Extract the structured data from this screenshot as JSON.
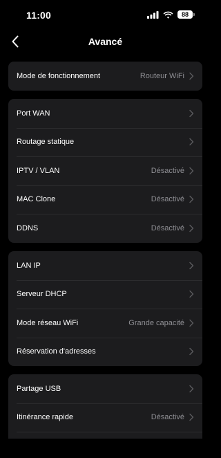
{
  "status": {
    "time": "11:00",
    "battery": "88",
    "icons": [
      "signal-icon",
      "wifi-icon",
      "battery-icon"
    ]
  },
  "nav": {
    "title": "Avancé",
    "back_icon": "chevron-left-icon"
  },
  "groups": [
    {
      "rows": [
        {
          "label": "Mode de fonctionnement",
          "value": "Routeur WiFi"
        }
      ]
    },
    {
      "rows": [
        {
          "label": "Port WAN",
          "value": ""
        },
        {
          "label": "Routage statique",
          "value": ""
        },
        {
          "label": "IPTV / VLAN",
          "value": "Désactivé"
        },
        {
          "label": "MAC Clone",
          "value": "Désactivé"
        },
        {
          "label": "DDNS",
          "value": "Désactivé"
        }
      ]
    },
    {
      "rows": [
        {
          "label": "LAN IP",
          "value": ""
        },
        {
          "label": "Serveur DHCP",
          "value": ""
        },
        {
          "label": "Mode réseau WiFi",
          "value": "Grande capacité"
        },
        {
          "label": "Réservation d'adresses",
          "value": ""
        }
      ]
    },
    {
      "rows": [
        {
          "label": "Partage USB",
          "value": ""
        },
        {
          "label": "Itinérance rapide",
          "value": "Désactivé"
        }
      ]
    }
  ],
  "colors": {
    "background": "#000000",
    "card": "#1c1c1e",
    "divider": "#2c2c2e",
    "secondary_text": "#8e8e93",
    "chevron": "#5a5a5e"
  }
}
